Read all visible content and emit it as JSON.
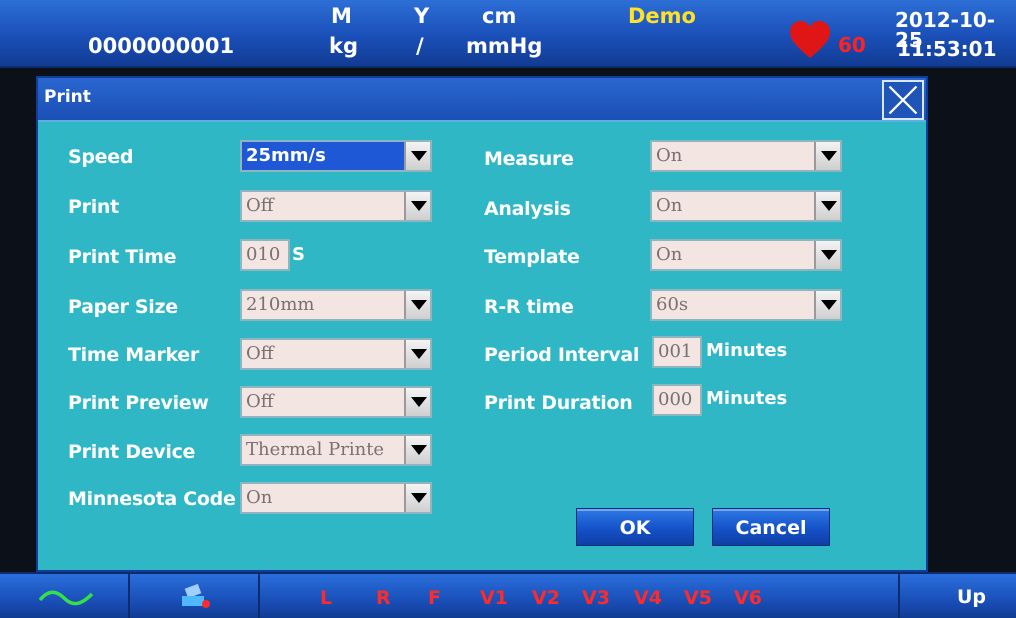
{
  "topbar": {
    "patient_id": "0000000001",
    "gender": "M",
    "weight_unit": "kg",
    "age_unit": "Y",
    "separator": "/",
    "height_unit": "cm",
    "bp_unit": "mmHg",
    "mode": "Demo",
    "heart_rate": "60",
    "date": "2012-10-25",
    "time": "11:53:01"
  },
  "dialog": {
    "title": "Print",
    "left": [
      {
        "label": "Speed",
        "value": "25mm/s",
        "type": "select"
      },
      {
        "label": "Print",
        "value": "Off",
        "type": "select"
      },
      {
        "label": "Print Time",
        "value": "010",
        "unit": "S",
        "type": "input"
      },
      {
        "label": "Paper Size",
        "value": "210mm",
        "type": "select"
      },
      {
        "label": "Time Marker",
        "value": "Off",
        "type": "select"
      },
      {
        "label": "Print Preview",
        "value": "Off",
        "type": "select"
      },
      {
        "label": "Print Device",
        "value": "Thermal Printe",
        "type": "select"
      },
      {
        "label": "Minnesota Code",
        "value": "On",
        "type": "select"
      }
    ],
    "right": [
      {
        "label": "Measure",
        "value": "On",
        "type": "select"
      },
      {
        "label": "Analysis",
        "value": "On",
        "type": "select"
      },
      {
        "label": "Template",
        "value": "On",
        "type": "select"
      },
      {
        "label": "R-R time",
        "value": "60s",
        "type": "select"
      },
      {
        "label": "Period Interval",
        "value": "001",
        "unit": "Minutes",
        "type": "input"
      },
      {
        "label": "Print Duration",
        "value": "000",
        "unit": "Minutes",
        "type": "input"
      }
    ],
    "ok_label": "OK",
    "cancel_label": "Cancel"
  },
  "bottombar": {
    "leads": [
      "L",
      "R",
      "F",
      "V1",
      "V2",
      "V3",
      "V4",
      "V5",
      "V6"
    ],
    "up_label": "Up"
  },
  "colors": {
    "dialog_bg": "#2fb7c6",
    "bar_blue": "#1a4fb8",
    "lead_red": "#ff2a2a",
    "demo_yellow": "#ffe02a",
    "heart_red": "#e01515"
  },
  "icons": [
    "heart-icon",
    "close-icon",
    "waveform-icon",
    "printer-icon",
    "dropdown-arrow-icon"
  ]
}
